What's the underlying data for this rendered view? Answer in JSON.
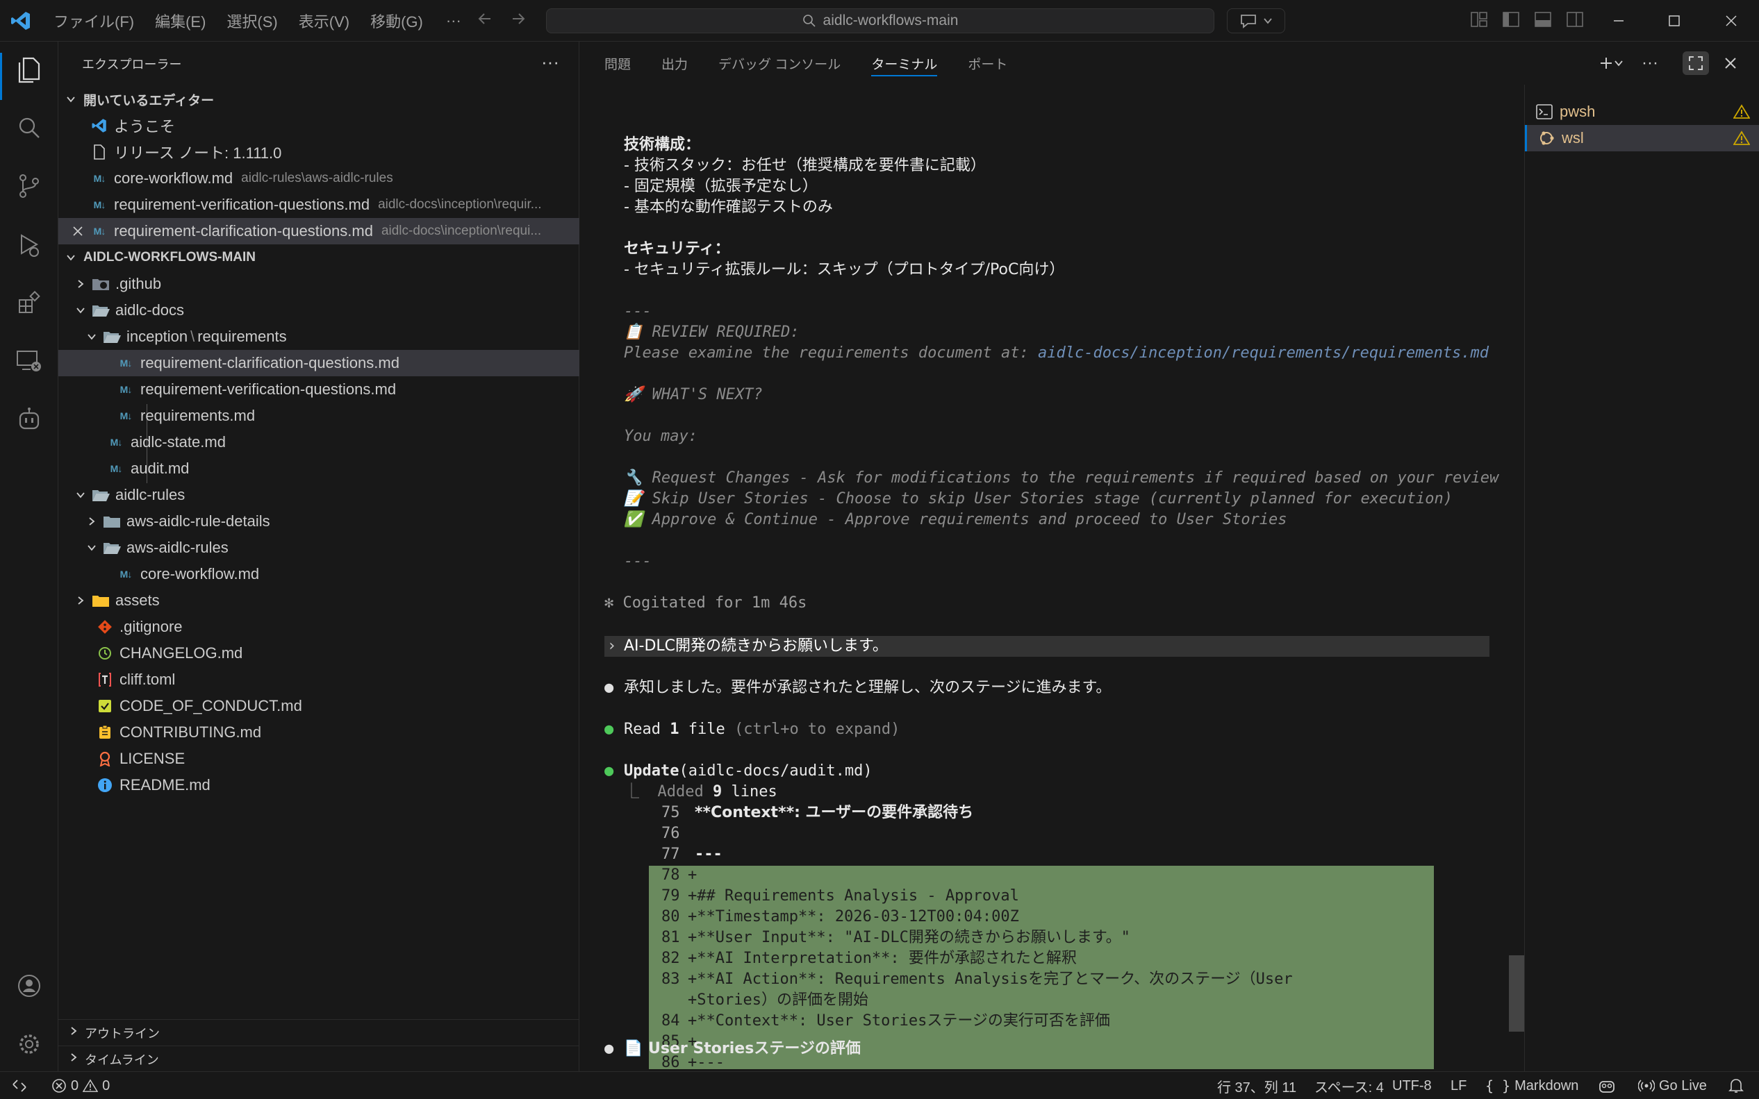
{
  "menubar": {
    "items": [
      "ファイル(F)",
      "編集(E)",
      "選択(S)",
      "表示(V)",
      "移動(G)"
    ],
    "more": "···"
  },
  "command_center": {
    "text": "aidlc-workflows-main"
  },
  "sidebar": {
    "header": "エクスプローラー",
    "more": "···",
    "open_editors": {
      "title": "開いているエディター",
      "items": [
        {
          "name": "ようこそ",
          "desc": "",
          "icon": "vscode-icon"
        },
        {
          "name": "リリース ノート: 1.111.0",
          "desc": "",
          "icon": "file-icon"
        },
        {
          "name": "core-workflow.md",
          "desc": "aidlc-rules\\aws-aidlc-rules",
          "icon": "markdown-icon"
        },
        {
          "name": "requirement-verification-questions.md",
          "desc": "aidlc-docs\\inception\\requir...",
          "icon": "markdown-icon"
        },
        {
          "name": "requirement-clarification-questions.md",
          "desc": "aidlc-docs\\inception\\requi...",
          "icon": "markdown-icon"
        }
      ]
    },
    "workspace": {
      "title": "AIDLC-WORKFLOWS-MAIN",
      "items": [
        {
          "name": ".github"
        },
        {
          "name": "aidlc-docs"
        },
        {
          "name": "inception",
          "sep": "\\",
          "name2": "requirements"
        },
        {
          "name": "requirement-clarification-questions.md"
        },
        {
          "name": "requirement-verification-questions.md"
        },
        {
          "name": "requirements.md"
        },
        {
          "name": "aidlc-state.md"
        },
        {
          "name": "audit.md"
        },
        {
          "name": "aidlc-rules"
        },
        {
          "name": "aws-aidlc-rule-details"
        },
        {
          "name": "aws-aidlc-rules"
        },
        {
          "name": "core-workflow.md"
        },
        {
          "name": "assets"
        },
        {
          "name": ".gitignore"
        },
        {
          "name": "CHANGELOG.md"
        },
        {
          "name": "cliff.toml"
        },
        {
          "name": "CODE_OF_CONDUCT.md"
        },
        {
          "name": "CONTRIBUTING.md"
        },
        {
          "name": "LICENSE"
        },
        {
          "name": "README.md"
        }
      ]
    },
    "outline": "アウトライン",
    "timeline": "タイムライン"
  },
  "panel": {
    "tabs": [
      "問題",
      "出力",
      "デバッグ コンソール",
      "ターミナル",
      "ポート"
    ],
    "active_tab": "ターミナル"
  },
  "terminal": {
    "lines": {
      "l1": "技術構成：",
      "l2": "- 技術スタック：お任せ（推奨構成を要件書に記載）",
      "l3": "- 固定規模（拡張予定なし）",
      "l4": "- 基本的な動作確認テストのみ",
      "l5": "セキュリティ：",
      "l6": "- セキュリティ拡張ルール：スキップ（プロトタイプ/PoC向け）",
      "l7": "---",
      "l8": "📋 REVIEW REQUIRED:",
      "l9a": "Please examine the requirements document at: ",
      "l9b": "aidlc-docs/inception/requirements/requirements.md",
      "l10": "🚀 WHAT'S NEXT?",
      "l11": "You may:",
      "l12": "🔧 Request Changes - Ask for modifications to the requirements if required based on your review",
      "l13": "📝 Skip User Stories - Choose to skip User Stories stage (currently planned for execution)",
      "l14": "✅ Approve & Continue - Approve requirements and proceed to User Stories",
      "l15": "---",
      "l16": "✻ Cogitated for 1m 46s",
      "prompt": "AI-DLC開発の続きからお願いします。",
      "l17": "承知しました。要件が承認されたと理解し、次のステージに進みます。",
      "l18a": "Read ",
      "l18b": "1",
      "l18c": " file ",
      "l18d": "(ctrl+o to expand)",
      "l19a": "Update",
      "l19b": "(aidlc-docs/audit.md)",
      "l20a": "⎿  Added ",
      "l20b": "9",
      "l20c": " lines",
      "d75": "**Context**: ユーザーの要件承認待ち",
      "d76": "",
      "d77": "---",
      "d78": "+",
      "d79": "+## Requirements Analysis - Approval",
      "d80": "+**Timestamp**: 2026-03-12T00:04:00Z",
      "d81": "+**User Input**: \"AI-DLC開発の続きからお願いします。\"",
      "d82": "+**AI Interpretation**: 要件が承認されたと解釈",
      "d83": "+**AI Action**: Requirements Analysisを完了とマーク、次のステージ（User",
      "d83b": "+Stories）の評価を開始",
      "d84": "+**Context**: User Storiesステージの実行可否を評価",
      "d85": "+",
      "d86": "+---",
      "l21": "📄 User Storiesステージの評価"
    },
    "diff_numbers": [
      "75",
      "76",
      "77",
      "78",
      "79",
      "80",
      "81",
      "82",
      "83",
      "84",
      "85",
      "86"
    ]
  },
  "terminal_list": {
    "items": [
      {
        "name": "pwsh",
        "icon": "terminal-icon"
      },
      {
        "name": "wsl",
        "icon": "ubuntu-icon"
      }
    ]
  },
  "statusbar": {
    "errors": "0",
    "warnings": "0",
    "position": "行 37、列 11",
    "spaces": "スペース: 4",
    "encoding": "UTF-8",
    "eol": "LF",
    "language": "Markdown",
    "golive": "Go Live"
  },
  "colors": {
    "accent": "#0078d4",
    "diff_added_bg": "#6a8a5e",
    "warning": "#cca700"
  }
}
